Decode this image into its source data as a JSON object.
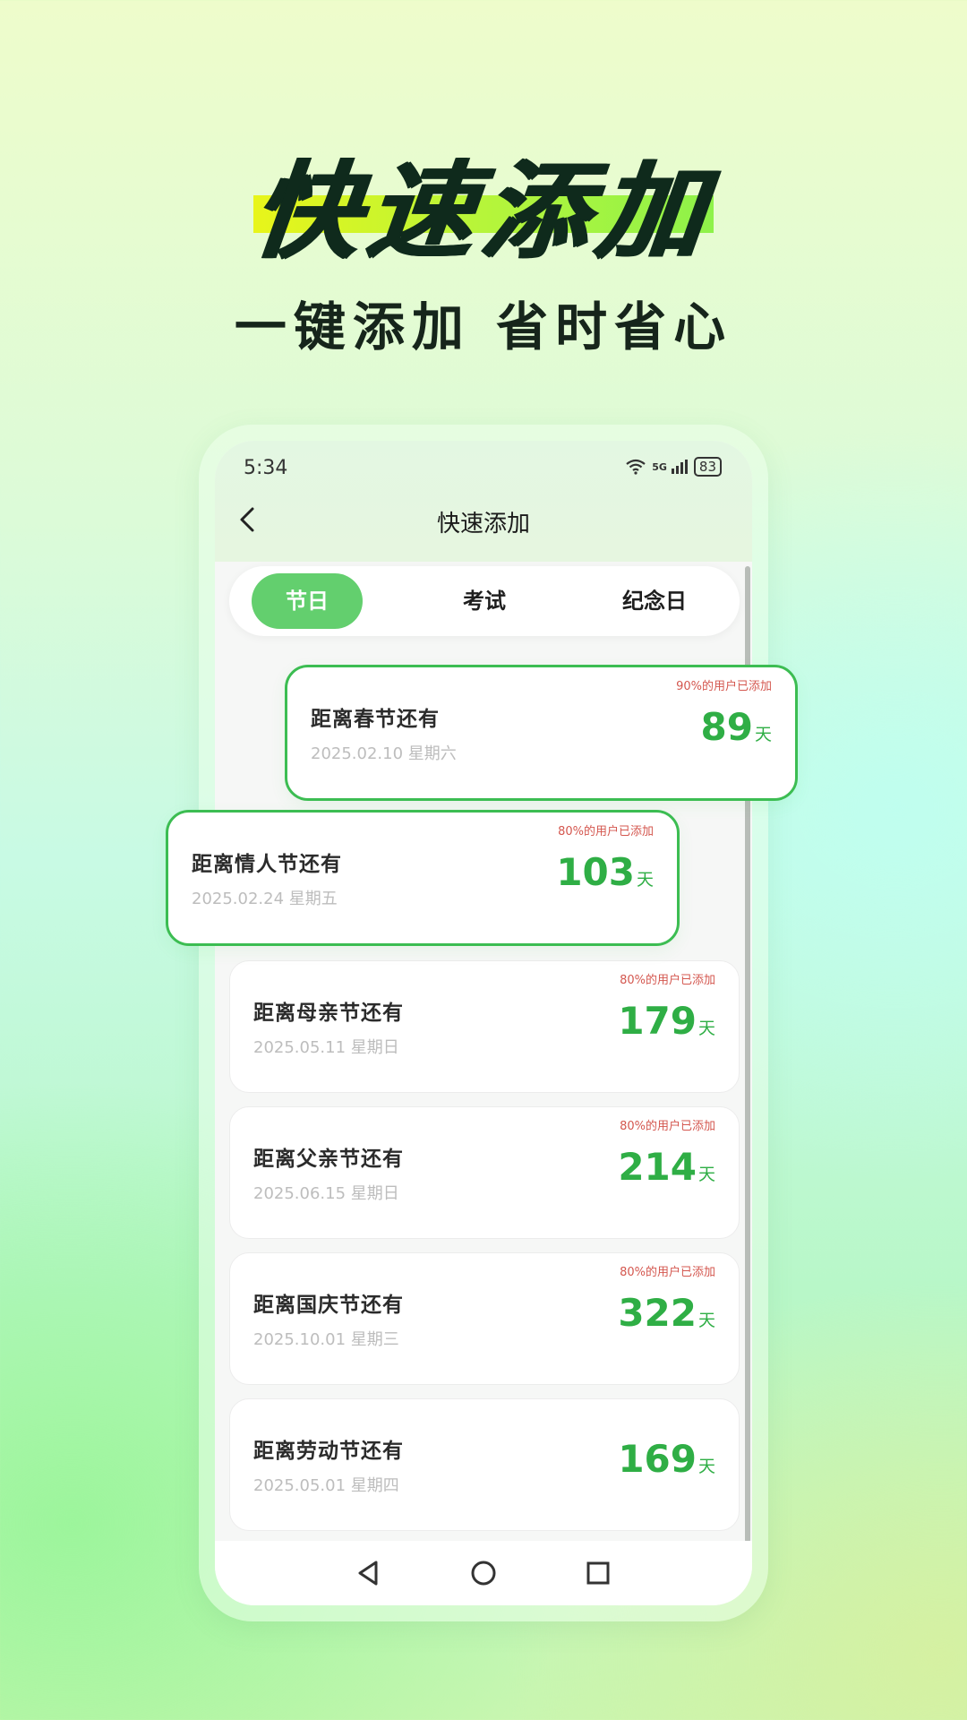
{
  "hero": {
    "title": "快速添加",
    "subtitle": "一键添加 省时省心"
  },
  "status_bar": {
    "time": "5:34",
    "network": "5G",
    "battery": "83"
  },
  "header": {
    "title": "快速添加"
  },
  "tabs": [
    {
      "label": "节日",
      "active": true
    },
    {
      "label": "考试",
      "active": false
    },
    {
      "label": "纪念日",
      "active": false
    }
  ],
  "cards": [
    {
      "title": "距离春节还有",
      "date": "2025.02.10 星期六",
      "hint": "90%的用户已添加",
      "days": "89",
      "unit": "天"
    },
    {
      "title": "距离情人节还有",
      "date": "2025.02.24 星期五",
      "hint": "80%的用户已添加",
      "days": "103",
      "unit": "天"
    },
    {
      "title": "距离母亲节还有",
      "date": "2025.05.11 星期日",
      "hint": "80%的用户已添加",
      "days": "179",
      "unit": "天"
    },
    {
      "title": "距离父亲节还有",
      "date": "2025.06.15 星期日",
      "hint": "80%的用户已添加",
      "days": "214",
      "unit": "天"
    },
    {
      "title": "距离国庆节还有",
      "date": "2025.10.01 星期三",
      "hint": "80%的用户已添加",
      "days": "322",
      "unit": "天"
    },
    {
      "title": "距离劳动节还有",
      "date": "2025.05.01 星期四",
      "hint": "",
      "days": "169",
      "unit": "天"
    }
  ],
  "colors": {
    "accent": "#63cf6e",
    "count": "#2fae45",
    "hint": "#d4574f",
    "pop_border": "#3cbd52"
  },
  "icons": [
    "back-arrow-icon",
    "wifi-icon",
    "signal-icon",
    "battery-icon",
    "nav-back-triangle-icon",
    "nav-home-circle-icon",
    "nav-recents-square-icon"
  ]
}
